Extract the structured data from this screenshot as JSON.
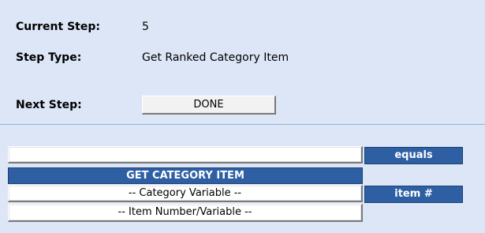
{
  "step_info": {
    "current_step_label": "Current Step:",
    "current_step_value": "5",
    "step_type_label": "Step Type:",
    "step_type_value": "Get Ranked Category Item",
    "next_step_label": "Next Step:",
    "next_step_button": "DONE"
  },
  "expression": {
    "result_field_value": "",
    "equals_label": "equals",
    "function_header": "GET CATEGORY ITEM",
    "category_variable_button": "-- Category Variable --",
    "item_label": "item #",
    "item_number_button": "-- Item Number/Variable --"
  },
  "colors": {
    "panel_background": "#dde6f7",
    "header_blue": "#2e5fa3",
    "divider": "#8fb1dc"
  }
}
